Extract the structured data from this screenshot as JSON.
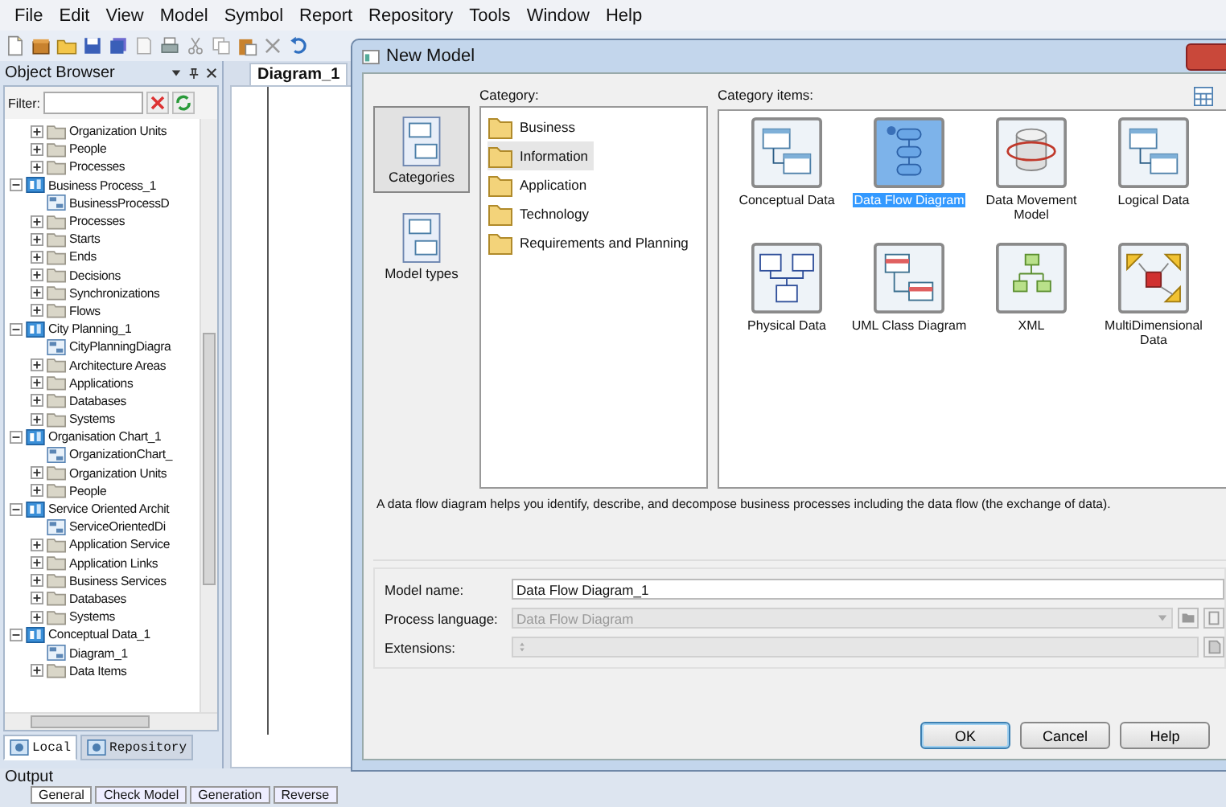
{
  "menu": [
    "File",
    "Edit",
    "View",
    "Model",
    "Symbol",
    "Report",
    "Repository",
    "Tools",
    "Window",
    "Help"
  ],
  "object_browser": {
    "title": "Object Browser",
    "filter": {
      "label": "Filter:"
    },
    "tree": {
      "continued": [
        {
          "label": "Organization Units",
          "kind": "folder",
          "expanded": false
        },
        {
          "label": "People",
          "kind": "folder",
          "expanded": false
        },
        {
          "label": "Processes",
          "kind": "folder",
          "expanded": false
        }
      ],
      "items": [
        {
          "label": "Business Process_1",
          "kind": "model",
          "expanded": true,
          "children": [
            {
              "label": "BusinessProcessD",
              "kind": "diagram"
            },
            {
              "label": "Processes",
              "kind": "folder",
              "expanded": false
            },
            {
              "label": "Starts",
              "kind": "folder",
              "expanded": false
            },
            {
              "label": "Ends",
              "kind": "folder",
              "expanded": false
            },
            {
              "label": "Decisions",
              "kind": "folder",
              "expanded": false
            },
            {
              "label": "Synchronizations",
              "kind": "folder",
              "expanded": false
            },
            {
              "label": "Flows",
              "kind": "folder",
              "expanded": false
            }
          ]
        },
        {
          "label": "City Planning_1",
          "kind": "model",
          "expanded": true,
          "children": [
            {
              "label": "CityPlanningDiagra",
              "kind": "diagram"
            },
            {
              "label": "Architecture Areas",
              "kind": "folder",
              "expanded": false
            },
            {
              "label": "Applications",
              "kind": "folder",
              "expanded": false
            },
            {
              "label": "Databases",
              "kind": "folder",
              "expanded": false
            },
            {
              "label": "Systems",
              "kind": "folder",
              "expanded": false
            }
          ]
        },
        {
          "label": "Organisation Chart_1",
          "kind": "model",
          "expanded": true,
          "children": [
            {
              "label": "OrganizationChart_",
              "kind": "diagram"
            },
            {
              "label": "Organization Units",
              "kind": "folder",
              "expanded": false
            },
            {
              "label": "People",
              "kind": "folder",
              "expanded": false
            }
          ]
        },
        {
          "label": "Service Oriented Archit",
          "kind": "model",
          "expanded": true,
          "children": [
            {
              "label": "ServiceOrientedDi",
              "kind": "diagram"
            },
            {
              "label": "Application Service",
              "kind": "folder",
              "expanded": false
            },
            {
              "label": "Application Links",
              "kind": "folder",
              "expanded": false
            },
            {
              "label": "Business Services",
              "kind": "folder",
              "expanded": false
            },
            {
              "label": "Databases",
              "kind": "folder",
              "expanded": false
            },
            {
              "label": "Systems",
              "kind": "folder",
              "expanded": false
            }
          ]
        },
        {
          "label": "Conceptual Data_1",
          "kind": "model",
          "expanded": true,
          "children": [
            {
              "label": "Diagram_1",
              "kind": "diagram"
            },
            {
              "label": "Data Items",
              "kind": "folder",
              "expanded": false
            }
          ]
        }
      ]
    },
    "bottom_tabs": [
      {
        "label": "Local",
        "selected": true
      },
      {
        "label": "Repository",
        "selected": false
      }
    ]
  },
  "diagram_tab": {
    "label": "Diagram_1"
  },
  "dialog": {
    "title": "New Model",
    "sidebar": [
      {
        "label": "Categories",
        "selected": true
      },
      {
        "label": "Model types",
        "selected": false
      }
    ],
    "category": {
      "label": "Category:",
      "items": [
        {
          "label": "Business",
          "selected": false
        },
        {
          "label": "Information",
          "selected": true
        },
        {
          "label": "Application",
          "selected": false
        },
        {
          "label": "Technology",
          "selected": false
        },
        {
          "label": "Requirements and Planning",
          "selected": false
        }
      ]
    },
    "category_items": {
      "label": "Category items:",
      "items": [
        {
          "label": "Conceptual Data",
          "kind": "entity",
          "selected": false
        },
        {
          "label": "Data Flow Diagram",
          "kind": "flow",
          "selected": true
        },
        {
          "label": "Data Movement Model",
          "kind": "cylinder",
          "selected": false
        },
        {
          "label": "Logical Data",
          "kind": "entity",
          "selected": false
        },
        {
          "label": "Physical Data",
          "kind": "tables",
          "selected": false
        },
        {
          "label": "UML Class Diagram",
          "kind": "uml",
          "selected": false
        },
        {
          "label": "XML",
          "kind": "xml",
          "selected": false
        },
        {
          "label": "MultiDimensional Data",
          "kind": "cube",
          "selected": false
        }
      ]
    },
    "description": "A data flow diagram helps you identify, describe, and decompose business processes including the data flow (the exchange of data).",
    "fields": [
      {
        "label": "Model name:",
        "kind": "text",
        "value": "Data Flow Diagram_1",
        "disabled": false
      },
      {
        "label": "Process language:",
        "kind": "dropdown",
        "value": "Data Flow Diagram",
        "disabled": true
      },
      {
        "label": "Extensions:",
        "kind": "spin",
        "disabled": true
      }
    ],
    "buttons": [
      {
        "label": "OK",
        "default": true
      },
      {
        "label": "Cancel",
        "default": false
      },
      {
        "label": "Help",
        "default": false
      }
    ]
  },
  "output": {
    "title": "Output",
    "tabs": [
      {
        "label": "General",
        "selected": true
      },
      {
        "label": "Check Model",
        "selected": false
      },
      {
        "label": "Generation",
        "selected": false
      },
      {
        "label": "Reverse",
        "selected": false
      }
    ]
  }
}
